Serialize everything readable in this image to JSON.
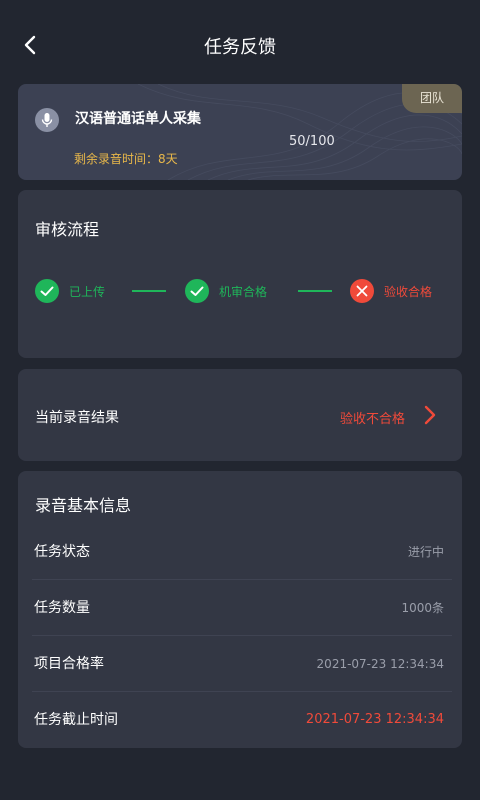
{
  "header": {
    "title": "任务反馈",
    "back_icon": "chevron-left-icon"
  },
  "task": {
    "name": "汉语普通话单人采集",
    "count": "50/100",
    "remaining": "剩余录音时间：8天",
    "badge": "团队",
    "icon": "microphone-icon"
  },
  "review": {
    "title": "审核流程",
    "steps": [
      {
        "label": "已上传",
        "status": "passed",
        "icon": "check-circle-icon"
      },
      {
        "label": "机审合格",
        "status": "passed",
        "icon": "check-circle-icon"
      },
      {
        "label": "验收合格",
        "status": "failed",
        "icon": "x-circle-icon"
      }
    ]
  },
  "result": {
    "label": "当前录音结果",
    "value": "验收不合格",
    "icon": "chevron-right-icon"
  },
  "info": {
    "title": "录音基本信息",
    "rows": [
      {
        "key": "任务状态",
        "value": "进行中"
      },
      {
        "key": "任务数量",
        "value": "1000条"
      },
      {
        "key": "项目合格率",
        "value": "2021-07-23   12:34:34"
      },
      {
        "key": "任务截止时间",
        "value": "2021-07-23   12:34:34"
      }
    ]
  },
  "colors": {
    "background": "#222630",
    "card": "#333744",
    "success": "#1fb65a",
    "error": "#f04a3a",
    "warning": "#e9b84a"
  }
}
